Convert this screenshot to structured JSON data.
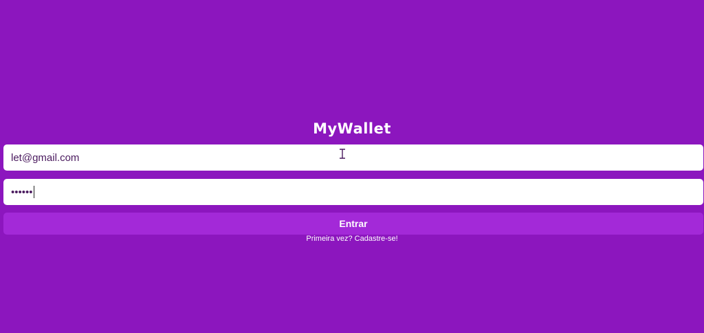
{
  "app": {
    "logo_text": "MyWallet"
  },
  "login_form": {
    "email_value": "let@gmail.com",
    "password_masked": "••••••",
    "submit_label": "Entrar",
    "signup_link_label": "Primeira vez? Cadastre-se!"
  },
  "colors": {
    "background": "#8c16be",
    "button": "#a329d8",
    "input_background": "#ffffff"
  },
  "icons": {
    "pointer": "text-cursor-icon"
  }
}
